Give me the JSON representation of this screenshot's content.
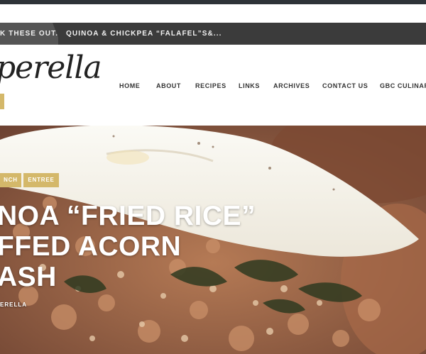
{
  "ticker": {
    "left_text": "K THESE OUT.",
    "headline": "QUINOA & CHICKPEA “FALAFEL”S&..."
  },
  "site": {
    "logo_text": "perella"
  },
  "nav": {
    "items": [
      "HOME",
      "ABOUT",
      "RECIPES",
      "LINKS",
      "ARCHIVES",
      "CONTACT US",
      "GBC CULINARY"
    ]
  },
  "post": {
    "tags": [
      "NCH",
      "ENTREE"
    ],
    "title_lines": [
      "NOA “FRIED RICE”",
      "FFED ACORN",
      "ASH"
    ],
    "author": "ERELLA"
  },
  "colors": {
    "accent": "#d4b86a",
    "ticker_bg": "#3b3b3b",
    "topbar": "#2e3338"
  }
}
